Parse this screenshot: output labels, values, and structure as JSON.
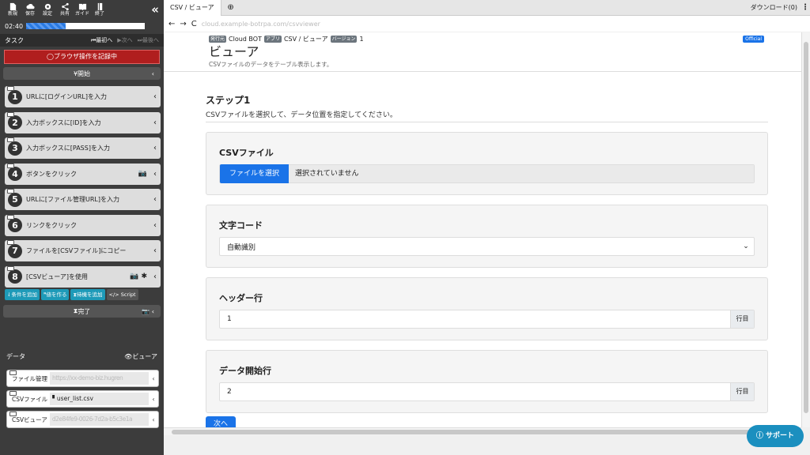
{
  "toolbar": {
    "items": [
      {
        "label": "新規",
        "icon": "new-file-icon"
      },
      {
        "label": "保存",
        "icon": "cloud-save-icon"
      },
      {
        "label": "設定",
        "icon": "gear-icon"
      },
      {
        "label": "共有",
        "icon": "share-icon"
      },
      {
        "label": "ガイド",
        "icon": "book-icon"
      },
      {
        "label": "終了",
        "icon": "exit-icon"
      }
    ],
    "collapse": "«"
  },
  "timer": {
    "time": "02:40",
    "progress": 0.33
  },
  "task": {
    "title": "タスク",
    "first": "最初へ",
    "next": "次へ",
    "last": "最後へ"
  },
  "recording": "ブラウザ操作を記録中",
  "start": "開始",
  "steps": [
    {
      "num": "1",
      "label": "URLに[ログインURL]を入力"
    },
    {
      "num": "2",
      "label": "入力ボックスに[ID]を入力"
    },
    {
      "num": "3",
      "label": "入力ボックスに[PASS]を入力"
    },
    {
      "num": "4",
      "label": "ボタンをクリック"
    },
    {
      "num": "5",
      "label": "URLに[ファイル管理URL]を入力"
    },
    {
      "num": "6",
      "label": "リンクをクリック"
    },
    {
      "num": "7",
      "label": "ファイルを[CSVファイル]にコピー"
    },
    {
      "num": "8",
      "label": "[CSVビューア]を使用"
    }
  ],
  "tools": [
    "条件を追加",
    "値を作る",
    "待機を追加",
    "Script"
  ],
  "end": "完了",
  "data_panel": {
    "title": "データ",
    "viewer": "ビューア",
    "items": [
      {
        "label": "ファイル管理",
        "value": "https://xx-demo-biz.hugren"
      },
      {
        "label": "CSVファイル",
        "value": "user_list.csv"
      },
      {
        "label": "CSVビューア",
        "value": "d2e84fe9-0026-7d2a-b5c3e1a"
      }
    ]
  },
  "browser": {
    "tab": "CSV / ビューア",
    "new_tab": "⊕",
    "download": "ダウンロード(0)",
    "menu": "⋮",
    "url": "cloud.example-botrpa.com/csvviewer"
  },
  "page": {
    "badges": [
      {
        "tag": "発行元",
        "value": "Cloud BOT"
      },
      {
        "tag": "アプリ",
        "value": "CSV / ビューア"
      },
      {
        "tag": "バージョン",
        "value": "1"
      }
    ],
    "official": "Official",
    "title": "ビューア",
    "subtitle": "CSVファイルのデータをテーブル表示します。",
    "step_title": "ステップ1",
    "step_desc": "CSVファイルを選択して、データ位置を指定してください。",
    "csv_label": "CSVファイル",
    "file_button": "ファイルを選択",
    "file_status": "選択されていません",
    "encoding_label": "文字コード",
    "encoding_value": "自動識別",
    "header_label": "ヘッダー行",
    "header_value": "1",
    "header_suffix": "行目",
    "data_label": "データ開始行",
    "data_value": "2",
    "data_suffix": "行目",
    "next": "次へ"
  },
  "support": "サポート"
}
